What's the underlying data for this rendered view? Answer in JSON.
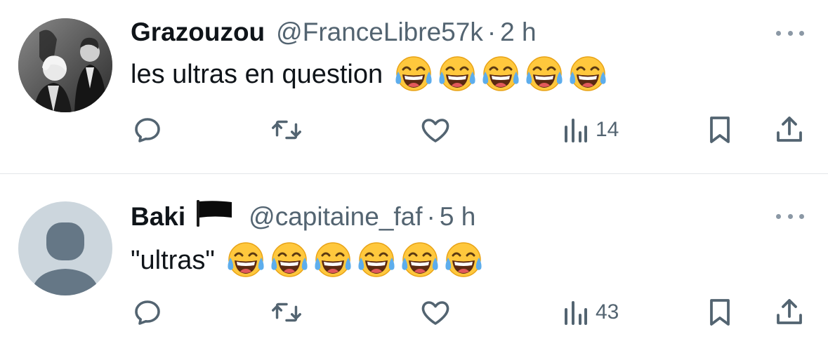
{
  "icons": {
    "reply": "reply-icon",
    "retweet": "retweet-icon",
    "like": "heart-icon",
    "views": "views-icon",
    "bookmark": "bookmark-icon",
    "share": "share-icon",
    "more": "more-dots-icon",
    "emoji": "face-with-tears-of-joy-emoji"
  },
  "colors": {
    "text": "#0f1419",
    "secondary": "#536471",
    "divider": "#e3e6e9",
    "icon": "#536471"
  },
  "tweets": [
    {
      "name": "Grazouzou",
      "handle": "@FranceLibre57k",
      "separator": "·",
      "time": "2 h",
      "text": "les ultras en question",
      "emoji": "😂",
      "emoji_count": 5,
      "views": "14"
    },
    {
      "name": "Baki",
      "flag": "black-flag",
      "handle": "@capitaine_faf",
      "separator": "·",
      "time": "5 h",
      "text": "\"ultras\"",
      "emoji": "😂",
      "emoji_count": 6,
      "views": "43"
    }
  ]
}
